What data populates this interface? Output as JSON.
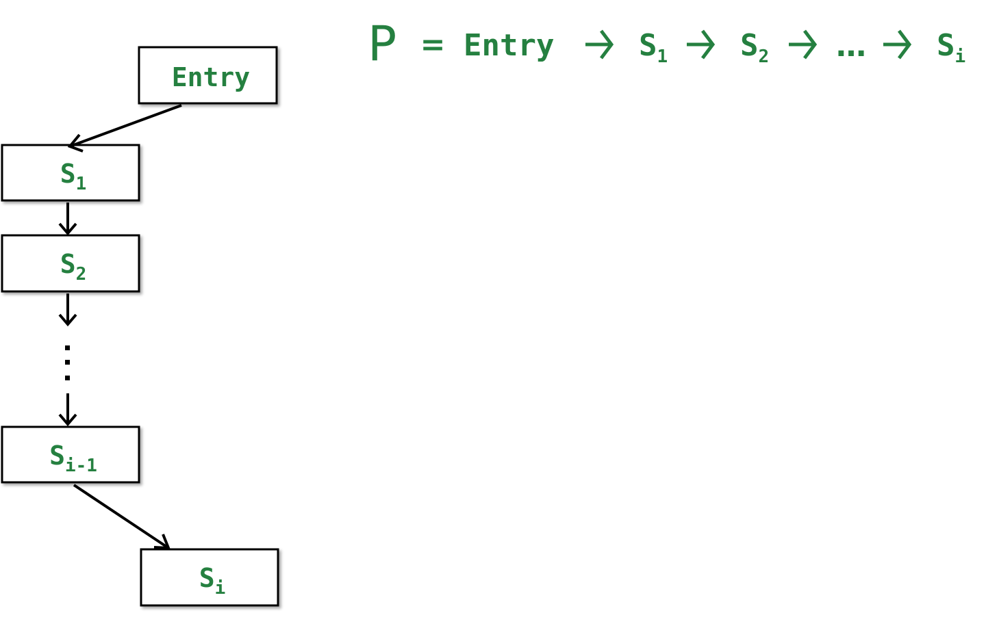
{
  "color_accent": "#258040",
  "nodes": {
    "entry": {
      "label": "Entry"
    },
    "s1": {
      "base": "S",
      "sub": "1"
    },
    "s2": {
      "base": "S",
      "sub": "2"
    },
    "sim1": {
      "base": "S",
      "sub": "i-1"
    },
    "si": {
      "base": "S",
      "sub": "i"
    }
  },
  "ellipsis_vertical": "⋮",
  "path_formula": {
    "symbol": "P",
    "equals": "=",
    "entry": "Entry",
    "s1": {
      "base": "S",
      "sub": "1"
    },
    "s2": {
      "base": "S",
      "sub": "2"
    },
    "ellipsis": "…",
    "si": {
      "base": "S",
      "sub": "i"
    },
    "arrow_icon": "right-arrow"
  }
}
